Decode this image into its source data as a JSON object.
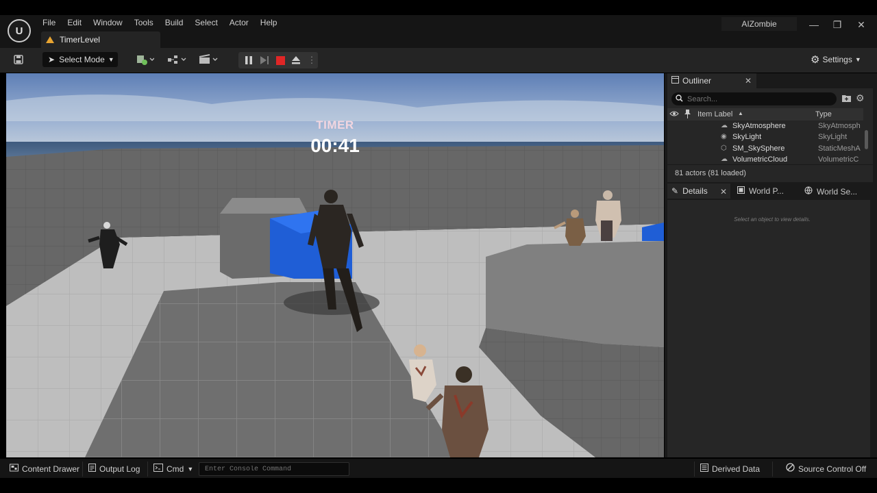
{
  "window": {
    "project_name": "AIZombie",
    "minimize": "—",
    "restore": "❐",
    "close": "✕"
  },
  "menu": [
    "File",
    "Edit",
    "Window",
    "Tools",
    "Build",
    "Select",
    "Actor",
    "Help"
  ],
  "level_tab": {
    "label": "TimerLevel"
  },
  "toolbar": {
    "mode_label": "Select Mode",
    "settings_label": "Settings"
  },
  "viewport": {
    "timer_title": "TIMER",
    "timer_value": "00:41"
  },
  "outliner": {
    "tab_label": "Outliner",
    "search_placeholder": "Search...",
    "col_label": "Item Label",
    "col_type": "Type",
    "rows": [
      {
        "name": "SkyAtmosphere",
        "type": "SkyAtmosph",
        "icon": "sky-atmosphere-icon"
      },
      {
        "name": "SkyLight",
        "type": "SkyLight",
        "icon": "sky-light-icon"
      },
      {
        "name": "SM_SkySphere",
        "type": "StaticMeshA",
        "icon": "static-mesh-icon"
      },
      {
        "name": "VolumetricCloud",
        "type": "VolumetricC",
        "icon": "cloud-icon"
      }
    ],
    "status": "81 actors (81 loaded)"
  },
  "details": {
    "tabs": [
      "Details",
      "World P...",
      "World Se..."
    ],
    "hint": "Select an object to view details."
  },
  "statusbar": {
    "content_drawer": "Content Drawer",
    "output_log": "Output Log",
    "cmd": "Cmd",
    "console_placeholder": "Enter Console Command",
    "derived_data": "Derived Data",
    "source_control": "Source Control Off"
  },
  "colors": {
    "stop_red": "#e02626",
    "warning_orange": "#e8a431",
    "panel_bg": "#262626",
    "sky_top": "#6f8fc4"
  }
}
